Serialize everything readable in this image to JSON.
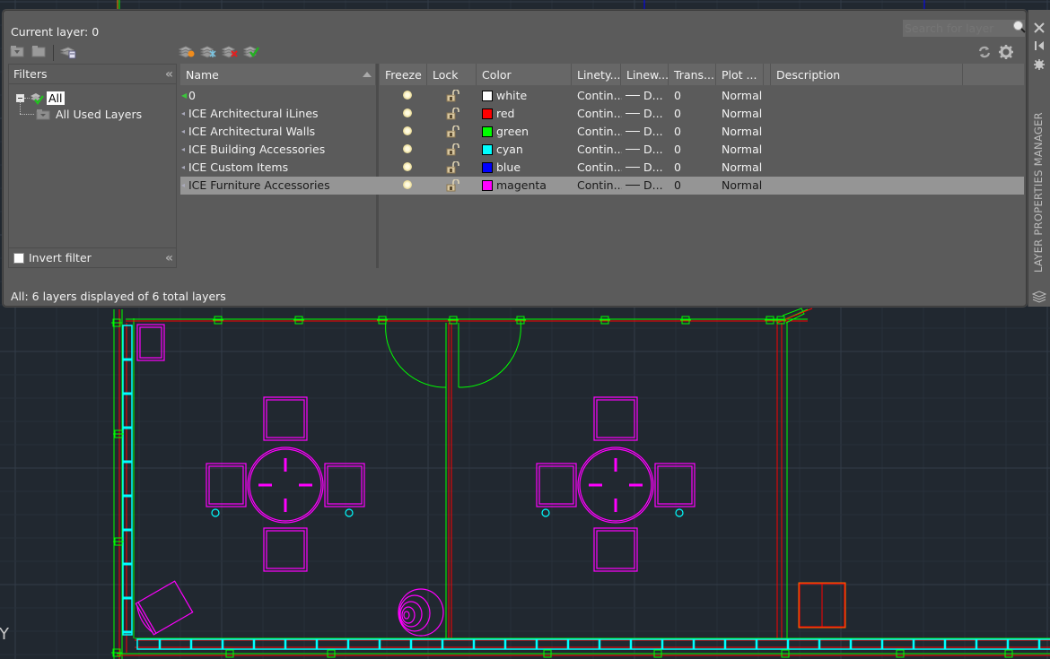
{
  "palette": {
    "title_vertical": "LAYER PROPERTIES MANAGER",
    "current_layer_label": "Current layer: 0",
    "search": {
      "placeholder": "Search for layer",
      "value": ""
    },
    "toolbar": {
      "left_icons": [
        "new-property-filter-icon",
        "new-group-filter-icon",
        "layer-states-manager-icon"
      ],
      "layer_icons": [
        "new-layer-icon",
        "new-layer-vp-frozen-icon",
        "delete-layer-icon",
        "set-current-icon"
      ],
      "right_icons": [
        "refresh-icon",
        "settings-icon"
      ]
    },
    "side_controls": [
      "close-icon",
      "auto-hide-icon",
      "properties-icon"
    ],
    "filters": {
      "header": "Filters",
      "collapse_glyph": "«",
      "tree": [
        {
          "label": "All",
          "selected": true,
          "expanded": true
        },
        {
          "label": "All Used Layers",
          "selected": false
        }
      ],
      "invert_filter_label": "Invert filter",
      "invert_filter_checked": false
    },
    "columns": [
      "Name",
      "Freeze",
      "Lock",
      "Color",
      "Linety...",
      "Linew...",
      "Trans...",
      "Plot ...",
      "Description"
    ],
    "layers": [
      {
        "name": "0",
        "current": true,
        "freeze": "thawed",
        "lock": "unlocked",
        "color_name": "white",
        "color_hex": "#ffffff",
        "linetype": "Contin...",
        "lineweight": "D...",
        "transparency": "0",
        "plot_style": "Normal",
        "description": "",
        "selected": false
      },
      {
        "name": "ICE Architectural iLines",
        "current": false,
        "freeze": "thawed",
        "lock": "unlocked",
        "color_name": "red",
        "color_hex": "#ff0000",
        "linetype": "Contin...",
        "lineweight": "D...",
        "transparency": "0",
        "plot_style": "Normal",
        "description": "",
        "selected": false
      },
      {
        "name": "ICE Architectural Walls",
        "current": false,
        "freeze": "thawed",
        "lock": "unlocked",
        "color_name": "green",
        "color_hex": "#00ff00",
        "linetype": "Contin...",
        "lineweight": "D...",
        "transparency": "0",
        "plot_style": "Normal",
        "description": "",
        "selected": false
      },
      {
        "name": "ICE Building Accessories",
        "current": false,
        "freeze": "thawed",
        "lock": "unlocked",
        "color_name": "cyan",
        "color_hex": "#00ffff",
        "linetype": "Contin...",
        "lineweight": "D...",
        "transparency": "0",
        "plot_style": "Normal",
        "description": "",
        "selected": false
      },
      {
        "name": "ICE Custom Items",
        "current": false,
        "freeze": "thawed",
        "lock": "unlocked",
        "color_name": "blue",
        "color_hex": "#0000ff",
        "linetype": "Contin...",
        "lineweight": "D...",
        "transparency": "0",
        "plot_style": "Normal",
        "description": "",
        "selected": false
      },
      {
        "name": "ICE Furniture Accessories",
        "current": false,
        "freeze": "thawed",
        "lock": "unlocked",
        "color_name": "magenta",
        "color_hex": "#ff00ff",
        "linetype": "Contin...",
        "lineweight": "D...",
        "transparency": "0",
        "plot_style": "Normal",
        "description": "",
        "selected": true
      }
    ],
    "status": "All: 6 layers displayed of 6 total layers"
  },
  "drawing": {
    "background": "#212830",
    "ucs_axis_label": "Y",
    "layer_colors": {
      "walls": "#00ff00",
      "ilines": "#ff0000",
      "building_accessories": "#00ffff",
      "furniture": "#ff00ff"
    }
  }
}
